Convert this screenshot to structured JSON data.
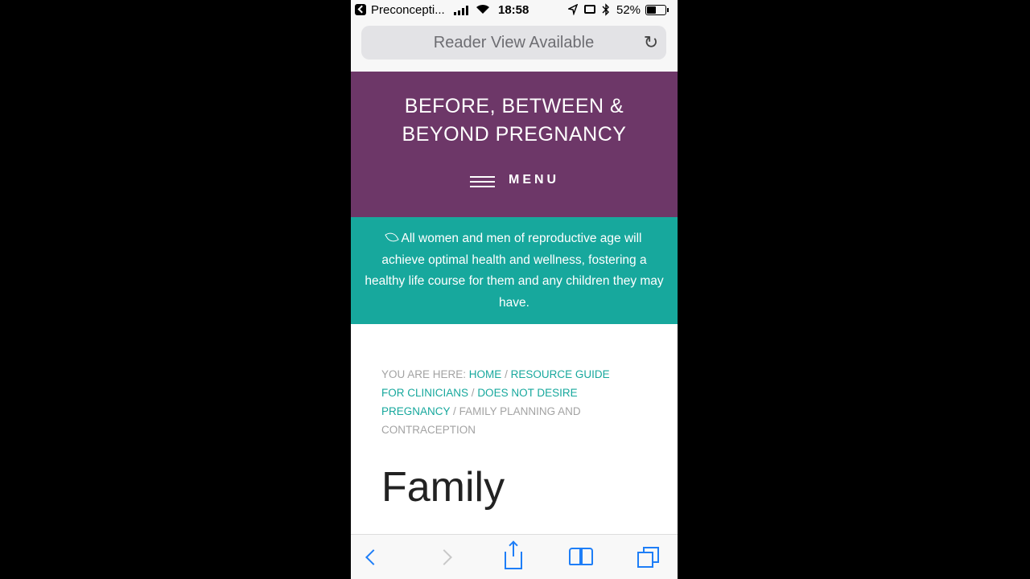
{
  "status_bar": {
    "app_name": "Preconcepti...",
    "time": "18:58",
    "battery_percent": "52%",
    "battery_level": 0.52
  },
  "url_bar": {
    "text": "Reader View Available"
  },
  "site": {
    "title_line1": "BEFORE, BETWEEN &",
    "title_line2": "BEYOND PREGNANCY",
    "menu_label": "MENU",
    "mission": "All women and men of reproductive age will achieve optimal health and wellness, fostering a healthy life course for them and any children they may have.",
    "colors": {
      "header": "#6d3768",
      "mission": "#17a89d",
      "link": "#17a89d"
    }
  },
  "breadcrumb": {
    "prefix": "YOU ARE HERE:",
    "home": "HOME",
    "level1": "RESOURCE GUIDE FOR CLINICIANS",
    "level2": "DOES NOT DESIRE PREGNANCY",
    "current": "FAMILY PLANNING AND CONTRACEPTION",
    "separator": "/"
  },
  "page": {
    "title_visible": "Family"
  },
  "toolbar": {
    "icons": [
      "back-icon",
      "forward-icon",
      "share-icon",
      "bookmarks-icon",
      "tabs-icon"
    ]
  }
}
